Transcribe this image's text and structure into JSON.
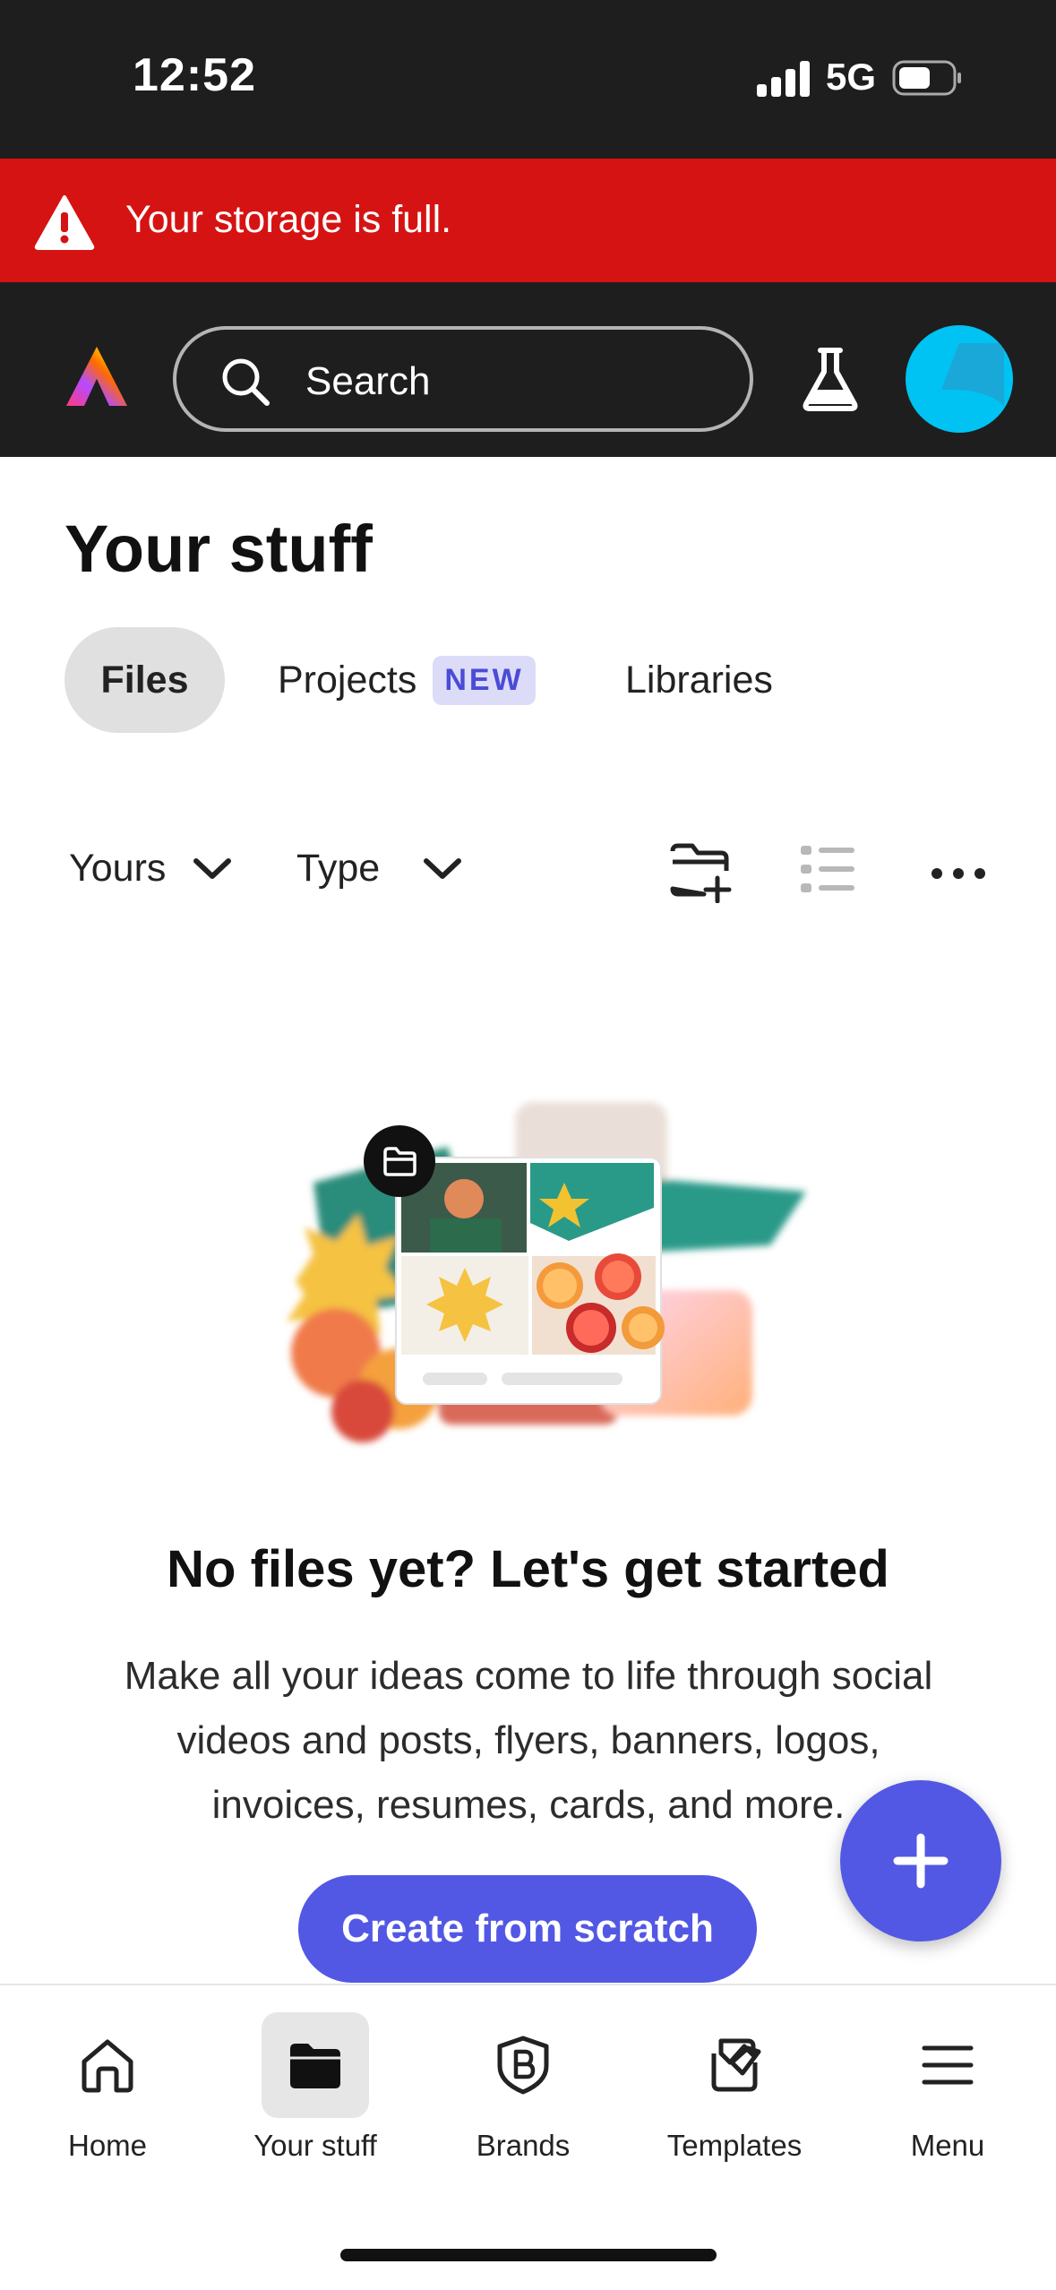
{
  "status_bar": {
    "time": "12:52",
    "network": "5G"
  },
  "alert": {
    "message": "Your storage is full."
  },
  "header": {
    "search_placeholder": "Search"
  },
  "page": {
    "title": "Your stuff",
    "tabs": [
      {
        "label": "Files",
        "active": true
      },
      {
        "label": "Projects",
        "badge": "NEW"
      },
      {
        "label": "Libraries"
      }
    ],
    "filters": {
      "owner": "Yours",
      "type": "Type"
    }
  },
  "empty_state": {
    "title": "No files yet? Let's get started",
    "description": "Make all your ideas come to life through social videos and posts, flyers, banners, logos, invoices, resumes, cards, and more.",
    "cta": "Create from scratch"
  },
  "bottom_nav": [
    {
      "label": "Home",
      "icon": "home-icon"
    },
    {
      "label": "Your stuff",
      "icon": "folder-icon",
      "active": true
    },
    {
      "label": "Brands",
      "icon": "brands-icon"
    },
    {
      "label": "Templates",
      "icon": "templates-icon"
    },
    {
      "label": "Menu",
      "icon": "menu-icon"
    }
  ],
  "colors": {
    "alert": "#d51313",
    "accent": "#5258e4",
    "avatar": "#00c2f3",
    "dark": "#1e1e1e"
  }
}
